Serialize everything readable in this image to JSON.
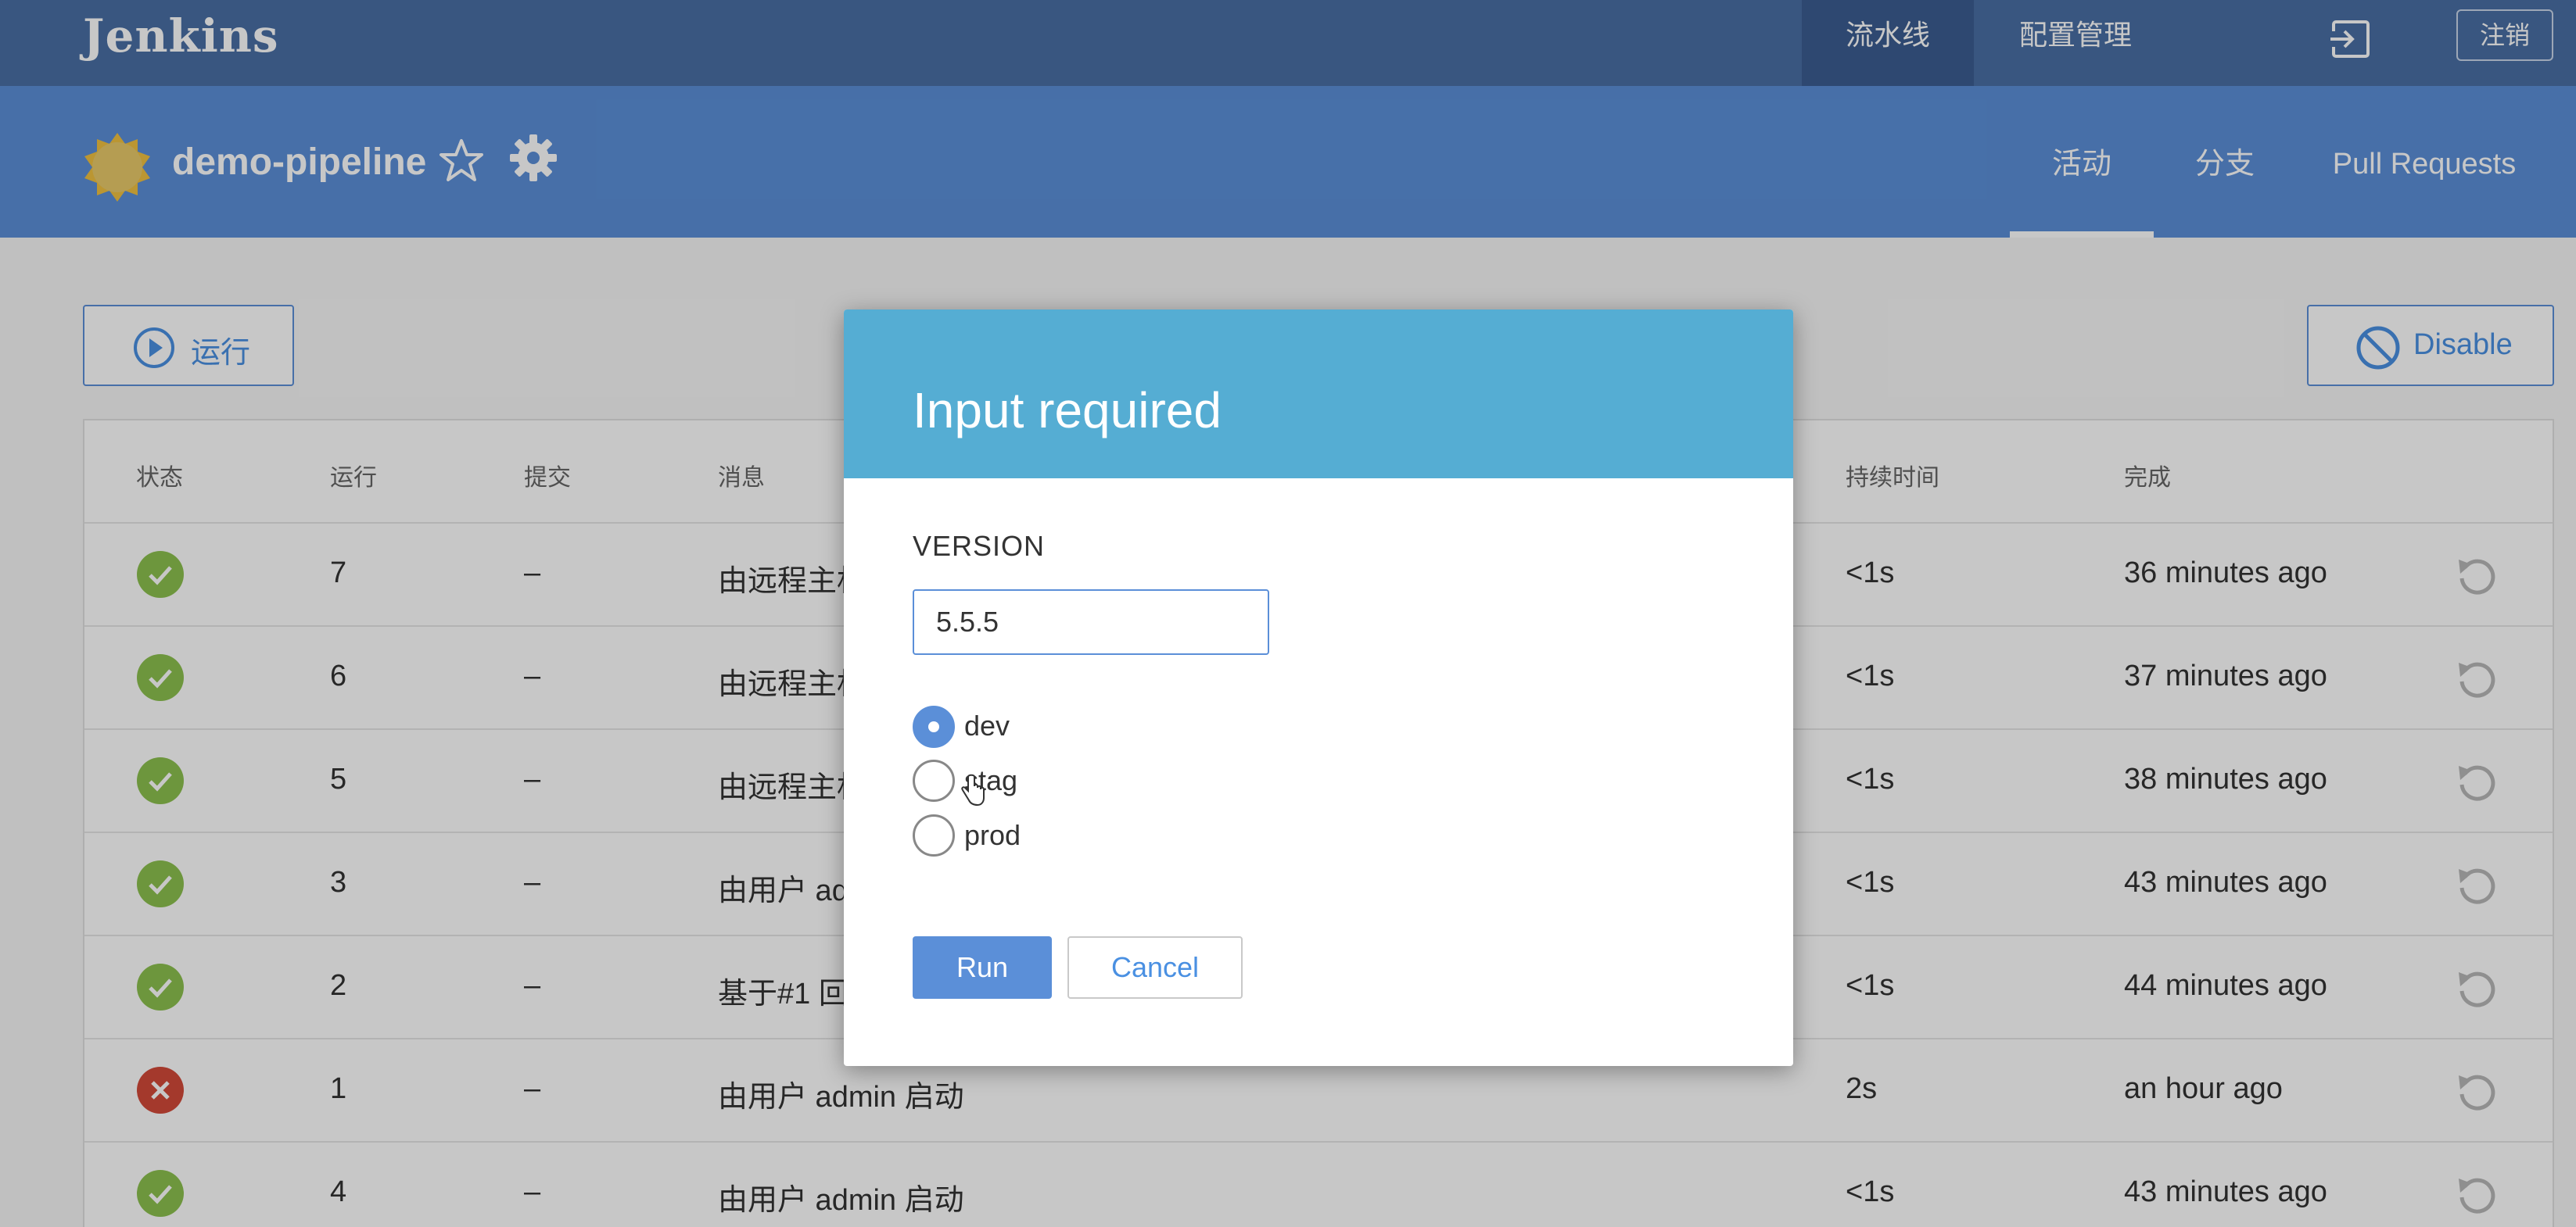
{
  "topbar": {
    "logo": "Jenkins",
    "nav": [
      {
        "label": "流水线"
      },
      {
        "label": "配置管理"
      }
    ],
    "logout_label": "注销"
  },
  "pipeline": {
    "name": "demo-pipeline",
    "tabs": [
      {
        "label": "活动"
      },
      {
        "label": "分支"
      },
      {
        "label": "Pull Requests"
      }
    ]
  },
  "actions": {
    "run_label": "运行",
    "disable_label": "Disable"
  },
  "table": {
    "headers": [
      "状态",
      "运行",
      "提交",
      "消息",
      "持续时间",
      "完成"
    ],
    "rows": [
      {
        "status": "success",
        "run": "7",
        "commit": "–",
        "message": "由远程主机",
        "duration": "<1s",
        "completed": "36 minutes ago"
      },
      {
        "status": "success",
        "run": "6",
        "commit": "–",
        "message": "由远程主机",
        "duration": "<1s",
        "completed": "37 minutes ago"
      },
      {
        "status": "success",
        "run": "5",
        "commit": "–",
        "message": "由远程主机",
        "duration": "<1s",
        "completed": "38 minutes ago"
      },
      {
        "status": "success",
        "run": "3",
        "commit": "–",
        "message": "由用户 ad",
        "duration": "<1s",
        "completed": "43 minutes ago"
      },
      {
        "status": "success",
        "run": "2",
        "commit": "–",
        "message": "基于#1 回",
        "duration": "<1s",
        "completed": "44 minutes ago"
      },
      {
        "status": "failed",
        "run": "1",
        "commit": "–",
        "message": "由用户 admin 启动",
        "duration": "2s",
        "completed": "an hour ago"
      },
      {
        "status": "success",
        "run": "4",
        "commit": "–",
        "message": "由用户 admin 启动",
        "duration": "<1s",
        "completed": "43 minutes ago"
      }
    ]
  },
  "dialog": {
    "title": "Input required",
    "field_label": "VERSION",
    "version_value": "5.5.5",
    "options": [
      {
        "label": "dev",
        "checked": true
      },
      {
        "label": "stag",
        "checked": false
      },
      {
        "label": "prod",
        "checked": false
      }
    ],
    "run_label": "Run",
    "cancel_label": "Cancel"
  },
  "colors": {
    "topbar": "#4a6fa5",
    "pipeline_header": "#5b8fd8",
    "dialog_header": "#55add3",
    "success": "#8cc04f",
    "failed": "#d24939",
    "accent": "#4a90e2"
  }
}
